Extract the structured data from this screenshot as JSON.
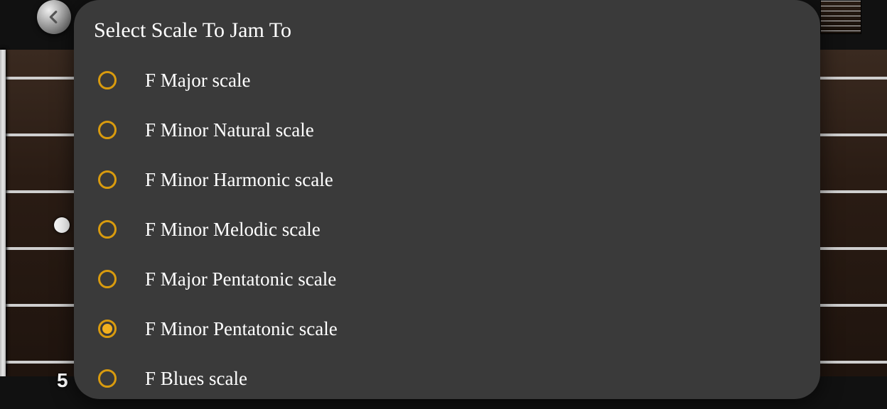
{
  "background": {
    "fret_number": "5"
  },
  "dialog": {
    "title": "Select Scale To Jam To",
    "options": [
      {
        "label": "F Major scale",
        "selected": false
      },
      {
        "label": "F Minor Natural scale",
        "selected": false
      },
      {
        "label": "F Minor Harmonic scale",
        "selected": false
      },
      {
        "label": "F Minor Melodic scale",
        "selected": false
      },
      {
        "label": "F Major Pentatonic scale",
        "selected": false
      },
      {
        "label": "F Minor Pentatonic scale",
        "selected": true
      },
      {
        "label": "F Blues scale",
        "selected": false
      }
    ]
  }
}
